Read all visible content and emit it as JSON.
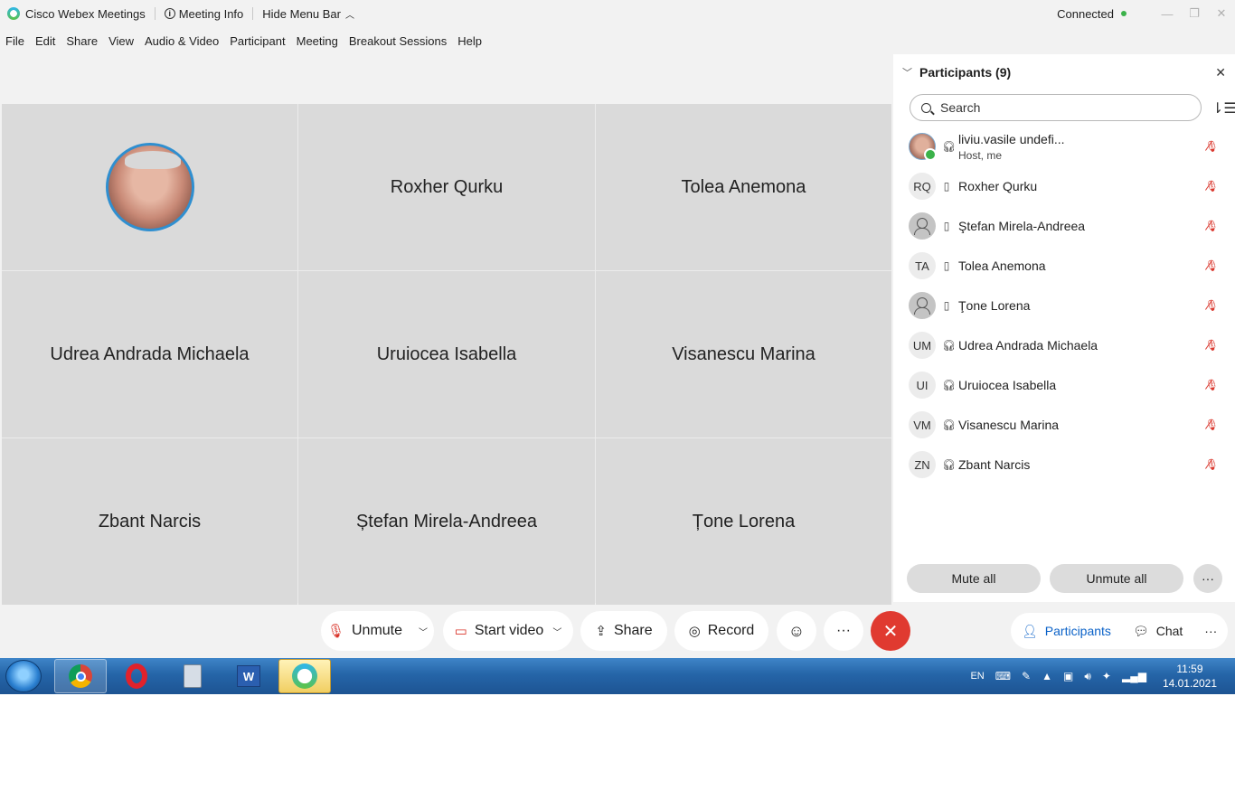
{
  "titlebar": {
    "app_name": "Cisco Webex Meetings",
    "meeting_info": "Meeting Info",
    "hide_menu": "Hide Menu Bar",
    "status": "Connected"
  },
  "menu": [
    "File",
    "Edit",
    "Share",
    "View",
    "Audio & Video",
    "Participant",
    "Meeting",
    "Breakout Sessions",
    "Help"
  ],
  "grid": {
    "tiles": [
      "",
      "Roxher Qurku",
      "Tolea Anemona",
      "Udrea Andrada Michaela",
      "Uruiocea Isabella",
      "Visanescu Marina",
      "Zbant Narcis",
      "Ștefan Mirela-Andreea",
      "Țone Lorena"
    ]
  },
  "panel": {
    "title": "Participants (9)",
    "search_placeholder": "Search",
    "participants": [
      {
        "initials": "",
        "name": "liviu.vasile undefi...",
        "sub": "Host, me",
        "device": "headset",
        "avatar": "photo"
      },
      {
        "initials": "RQ",
        "name": "Roxher Qurku",
        "sub": "",
        "device": "phone",
        "avatar": "initials"
      },
      {
        "initials": "",
        "name": "Ştefan Mirela-Andreea",
        "sub": "",
        "device": "phone",
        "avatar": "generic"
      },
      {
        "initials": "TA",
        "name": "Tolea Anemona",
        "sub": "",
        "device": "phone",
        "avatar": "initials"
      },
      {
        "initials": "",
        "name": "Ţone Lorena",
        "sub": "",
        "device": "phone",
        "avatar": "generic"
      },
      {
        "initials": "UM",
        "name": "Udrea Andrada Michaela",
        "sub": "",
        "device": "headset",
        "avatar": "initials"
      },
      {
        "initials": "UI",
        "name": "Uruiocea Isabella",
        "sub": "",
        "device": "headset",
        "avatar": "initials"
      },
      {
        "initials": "VM",
        "name": "Visanescu Marina",
        "sub": "",
        "device": "headset",
        "avatar": "initials"
      },
      {
        "initials": "ZN",
        "name": "Zbant Narcis",
        "sub": "",
        "device": "headset",
        "avatar": "initials"
      }
    ],
    "mute_all": "Mute all",
    "unmute_all": "Unmute all",
    "more": "···"
  },
  "toolbar": {
    "unmute": "Unmute",
    "start_video": "Start video",
    "share": "Share",
    "record": "Record",
    "more": "···",
    "participants": "Participants",
    "chat": "Chat"
  },
  "taskbar": {
    "lang": "EN",
    "time": "11:59",
    "date": "14.01.2021"
  },
  "colors": {
    "accent": "#0b62c8",
    "leave": "#e03a30",
    "muted": "#d9342a",
    "connected": "#3bb24a"
  }
}
